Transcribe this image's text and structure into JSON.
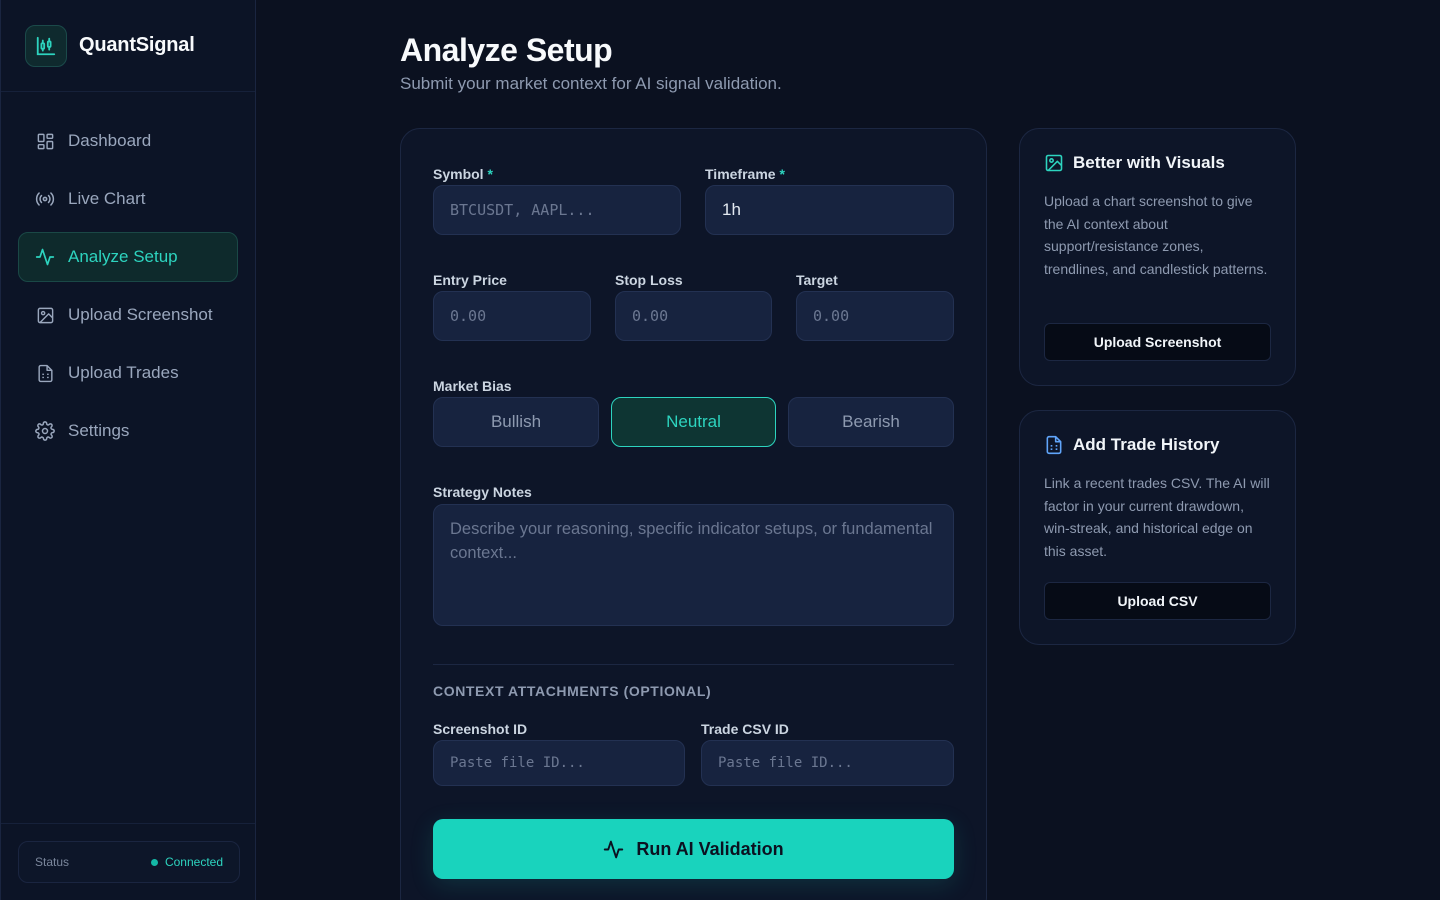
{
  "brand": {
    "name": "QuantSignal"
  },
  "nav": {
    "items": [
      {
        "label": "Dashboard",
        "icon": "dashboard-icon"
      },
      {
        "label": "Live Chart",
        "icon": "broadcast-icon"
      },
      {
        "label": "Analyze Setup",
        "icon": "activity-icon",
        "active": true
      },
      {
        "label": "Upload Screenshot",
        "icon": "image-icon"
      },
      {
        "label": "Upload Trades",
        "icon": "file-text-icon"
      },
      {
        "label": "Settings",
        "icon": "gear-icon"
      }
    ]
  },
  "status": {
    "label": "Status",
    "value": "Connected"
  },
  "header": {
    "title": "Analyze Setup",
    "subtitle": "Submit your market context for AI signal validation."
  },
  "form": {
    "symbol": {
      "label": "Symbol",
      "required": "*",
      "placeholder": "BTCUSDT, AAPL..."
    },
    "timeframe": {
      "label": "Timeframe",
      "required": "*",
      "value": "1h"
    },
    "entry": {
      "label": "Entry Price",
      "placeholder": "0.00"
    },
    "stop": {
      "label": "Stop Loss",
      "placeholder": "0.00"
    },
    "target": {
      "label": "Target",
      "placeholder": "0.00"
    },
    "bias": {
      "label": "Market Bias",
      "options": [
        "Bullish",
        "Neutral",
        "Bearish"
      ],
      "selected": "Neutral"
    },
    "notes": {
      "label": "Strategy Notes",
      "placeholder": "Describe your reasoning, specific indicator setups, or fundamental context..."
    },
    "attachments": {
      "heading": "CONTEXT ATTACHMENTS (OPTIONAL)",
      "screenshot": {
        "label": "Screenshot ID",
        "placeholder": "Paste file ID..."
      },
      "csv": {
        "label": "Trade CSV ID",
        "placeholder": "Paste file ID..."
      }
    },
    "submit": "Run AI Validation"
  },
  "cards": {
    "visuals": {
      "title": "Better with Visuals",
      "body": "Upload a chart screenshot to give the AI context about support/resistance zones, trendlines, and candlestick patterns.",
      "button": "Upload Screenshot"
    },
    "history": {
      "title": "Add Trade History",
      "body": "Link a recent trades CSV. The AI will factor in your current drawdown, win-streak, and historical edge on this asset.",
      "button": "Upload CSV"
    }
  },
  "colors": {
    "accent": "#2dd4bf",
    "background": "#0b1120",
    "card": "#0d1528"
  }
}
